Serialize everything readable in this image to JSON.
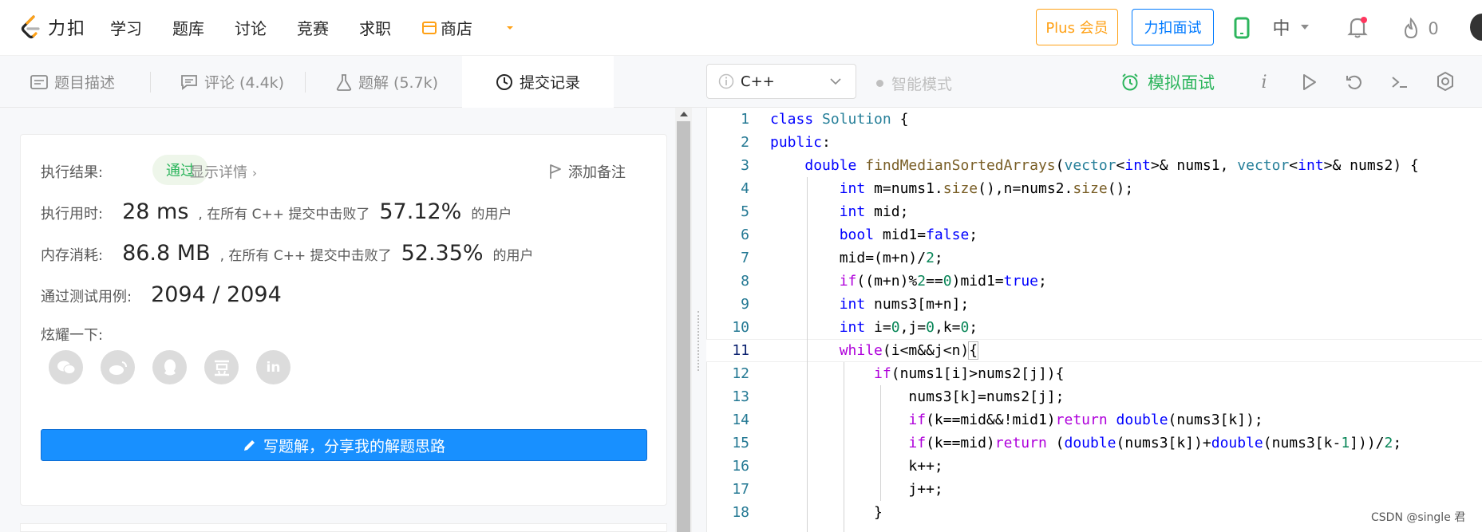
{
  "header": {
    "logo_text": "力扣",
    "nav": [
      "学习",
      "题库",
      "讨论",
      "竞赛",
      "求职"
    ],
    "store_label": "商店",
    "plus_label": "Plus 会员",
    "interview_label": "力扣面试",
    "lang_toggle": "中",
    "points": "0",
    "colors": {
      "brand": "#ffa116",
      "accent": "#007aff",
      "success": "#2db55d"
    }
  },
  "tabs": [
    {
      "label": "题目描述",
      "icon": "description-icon"
    },
    {
      "label": "评论 (4.4k)",
      "icon": "comment-icon"
    },
    {
      "label": "题解 (5.7k)",
      "icon": "flask-icon"
    },
    {
      "label": "提交记录",
      "icon": "clock-icon"
    }
  ],
  "editor_bar": {
    "language": "C++",
    "smart_mode": "智能模式",
    "mock_interview": "模拟面试"
  },
  "result": {
    "label_result": "执行结果:",
    "status": "通过",
    "details": "显示详情",
    "add_note": "添加备注",
    "label_time": "执行用时:",
    "time": "28 ms",
    "time_mid": ", 在所有 C++ 提交中击败了",
    "time_pct": "57.12%",
    "users": "的用户",
    "label_mem": "内存消耗:",
    "mem": "86.8 MB",
    "mem_mid": ", 在所有 C++ 提交中击败了",
    "mem_pct": "52.35%",
    "label_tests": "通过测试用例:",
    "tests": "2094 / 2094",
    "label_share": "炫耀一下:",
    "write_btn": "写题解，分享我的解题思路"
  },
  "code": {
    "lines": [
      "1",
      "2",
      "3",
      "4",
      "5",
      "6",
      "7",
      "8",
      "9",
      "10",
      "11",
      "12",
      "13",
      "14",
      "15",
      "16",
      "17",
      "18"
    ]
  },
  "watermark": "CSDN @single 君"
}
